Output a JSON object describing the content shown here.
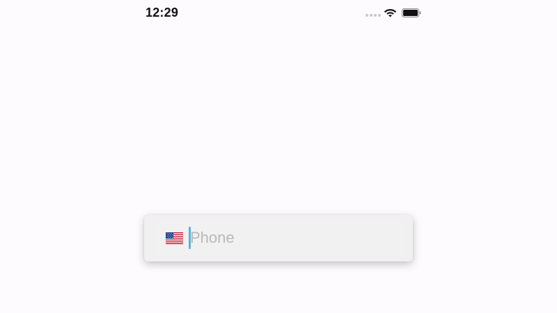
{
  "status_bar": {
    "time": "12:29",
    "signal_icon": "signal-dots-icon",
    "wifi_icon": "wifi-icon",
    "battery_icon": "battery-icon"
  },
  "phone_field": {
    "country_flag_icon": "us-flag-icon",
    "value": "",
    "placeholder": "Phone"
  },
  "colors": {
    "background": "#fdfbfd",
    "field_background": "#f0f0f0",
    "caret": "#5ab4d6",
    "placeholder": "#b9b9b9"
  }
}
